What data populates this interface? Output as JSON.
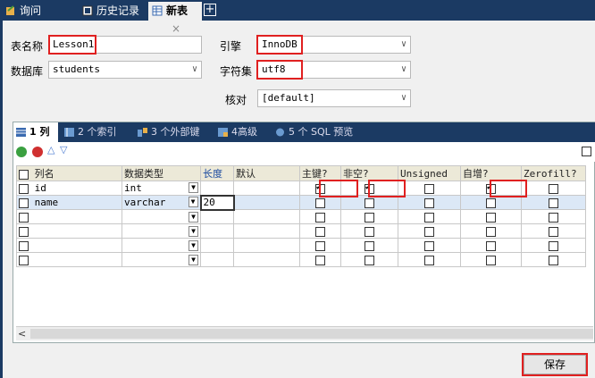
{
  "tabs": [
    {
      "label": "询问",
      "icon": "query-icon"
    },
    {
      "label": "历史记录",
      "icon": "history-icon"
    },
    {
      "label": "新表",
      "icon": "new-table-icon",
      "close": "×"
    }
  ],
  "form": {
    "table_name_label": "表名称",
    "table_name_value": "Lesson1",
    "database_label": "数据库",
    "database_value": "students",
    "engine_label": "引擎",
    "engine_value": "InnoDB",
    "charset_label": "字符集",
    "charset_value": "utf8",
    "collation_label": "核对",
    "collation_value": "[default]"
  },
  "subtabs": [
    {
      "label": "1 列"
    },
    {
      "label": "2 个索引"
    },
    {
      "label": "3 个外部键"
    },
    {
      "label": "4高级"
    },
    {
      "label": "5 个 SQL 预览"
    }
  ],
  "columns_headers": [
    "列名",
    "数据类型",
    "长度",
    "默认",
    "主键?",
    "非空?",
    "Unsigned",
    "自增?",
    "Zerofill?"
  ],
  "rows": [
    {
      "name": "id",
      "type": "int",
      "length": "",
      "default": "",
      "pk": true,
      "nn": true,
      "unsigned": false,
      "ai": true,
      "zf": false
    },
    {
      "name": "name",
      "type": "varchar",
      "length": "20",
      "default": "",
      "pk": false,
      "nn": false,
      "unsigned": false,
      "ai": false,
      "zf": false
    }
  ],
  "save_label": "保存",
  "colors": {
    "accent_dark": "#1b3a63",
    "highlight": "#e02020"
  }
}
